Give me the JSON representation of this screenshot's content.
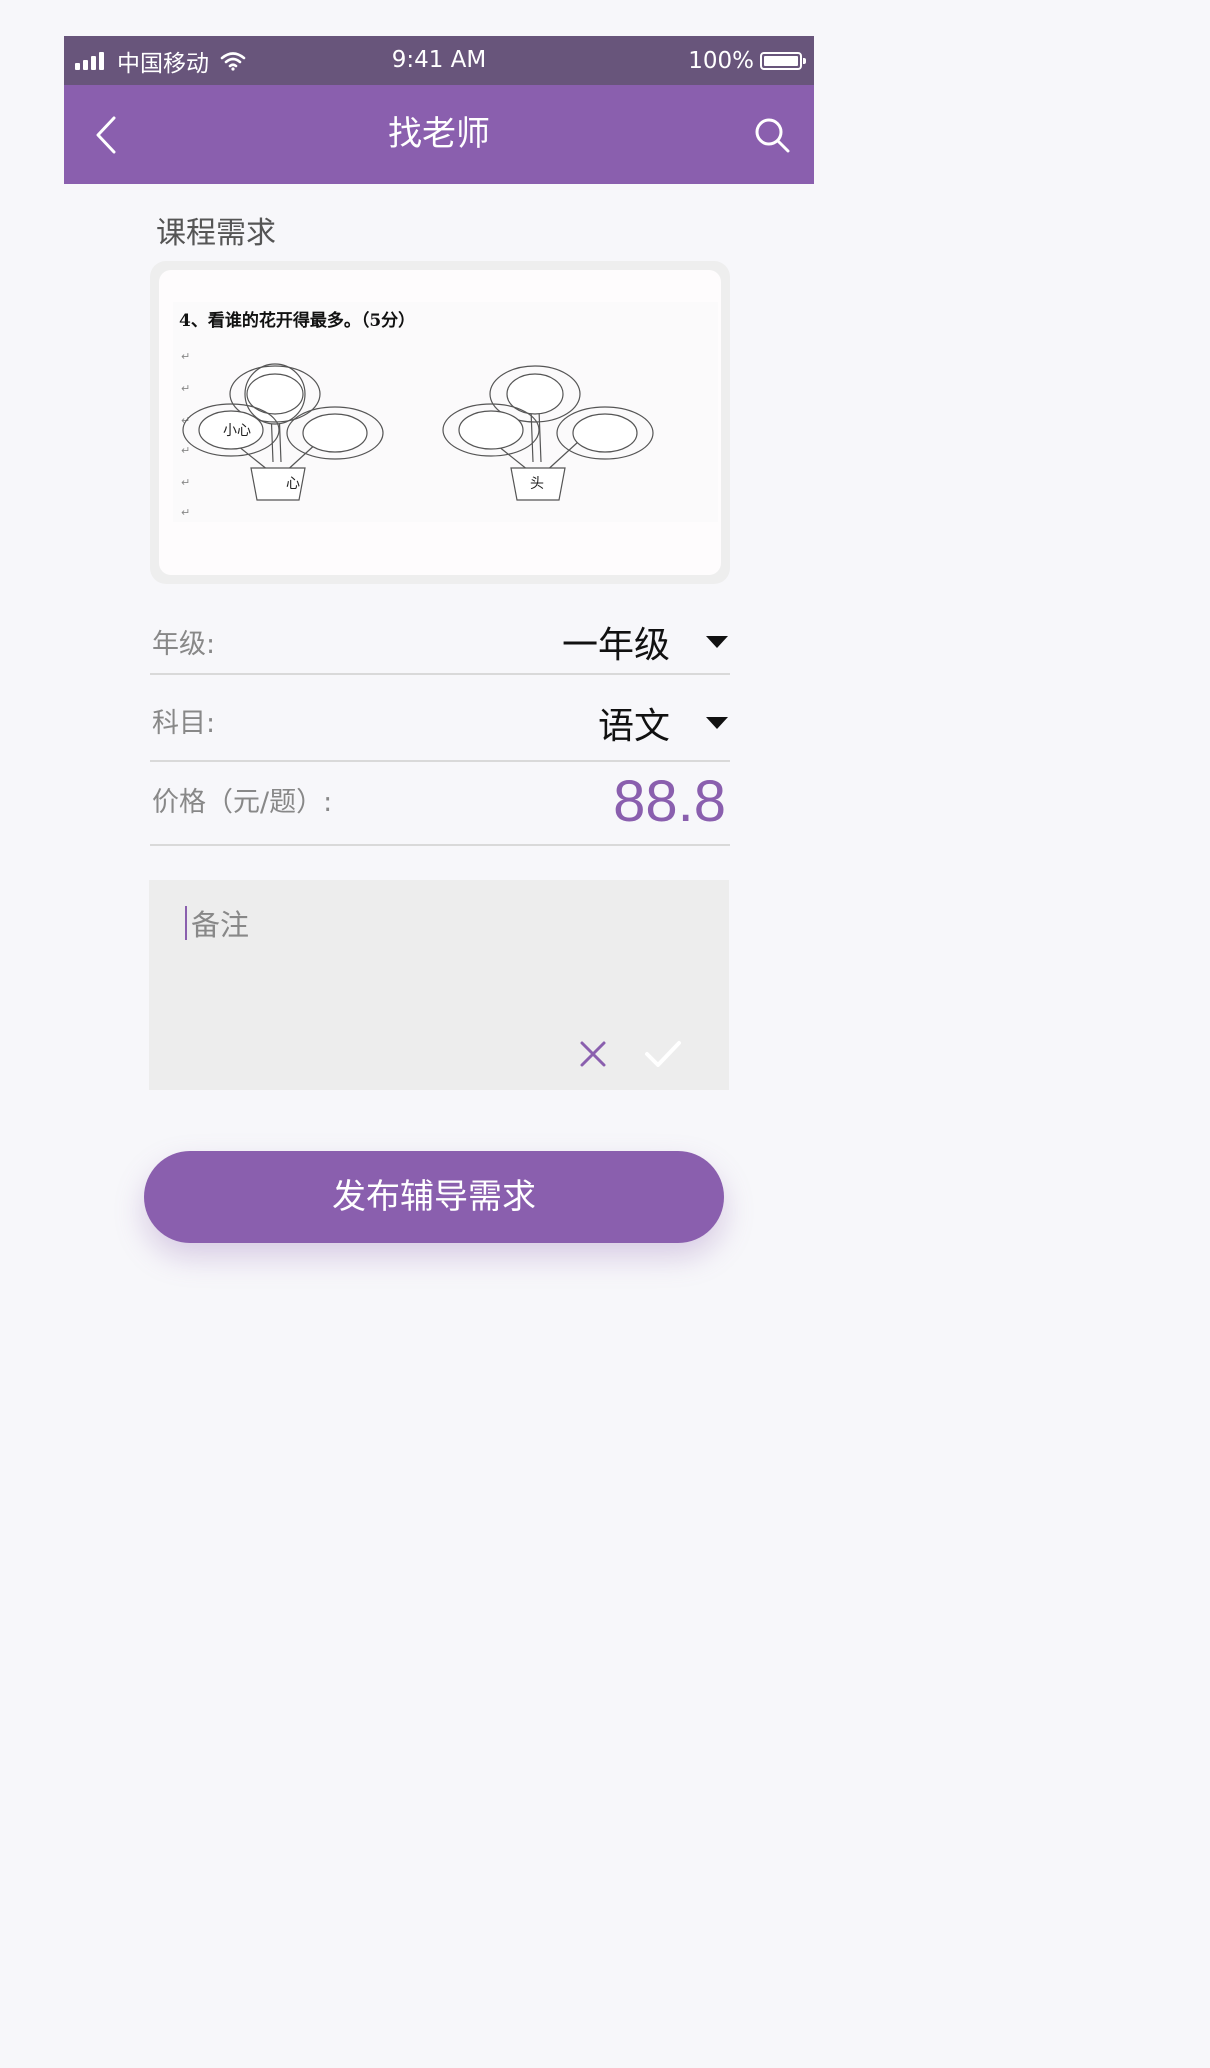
{
  "status_bar": {
    "carrier": "中国移动",
    "time": "9:41 AM",
    "battery": "100%",
    "icons": [
      "signal-icon",
      "wifi-icon",
      "battery-icon"
    ]
  },
  "nav": {
    "title": "找老师",
    "back_icon": "chevron-left-icon",
    "search_icon": "search-icon"
  },
  "course": {
    "section_title": "课程需求",
    "worksheet": {
      "question": "4、看谁的花开得最多。（5分）",
      "left_flower_label": "小心",
      "left_pot_label": "心",
      "right_pot_label": "头"
    }
  },
  "form": {
    "grade": {
      "label": "年级:",
      "value": "一年级"
    },
    "subject": {
      "label": "科目:",
      "value": "语文"
    },
    "price": {
      "label": "价格（元/题）:",
      "value": "88.8"
    },
    "notes": {
      "placeholder": "备注"
    }
  },
  "submit": {
    "label": "发布辅导需求"
  },
  "colors": {
    "accent": "#8a5fae",
    "status_bar": "#68557b",
    "background": "#f7f7fa"
  }
}
